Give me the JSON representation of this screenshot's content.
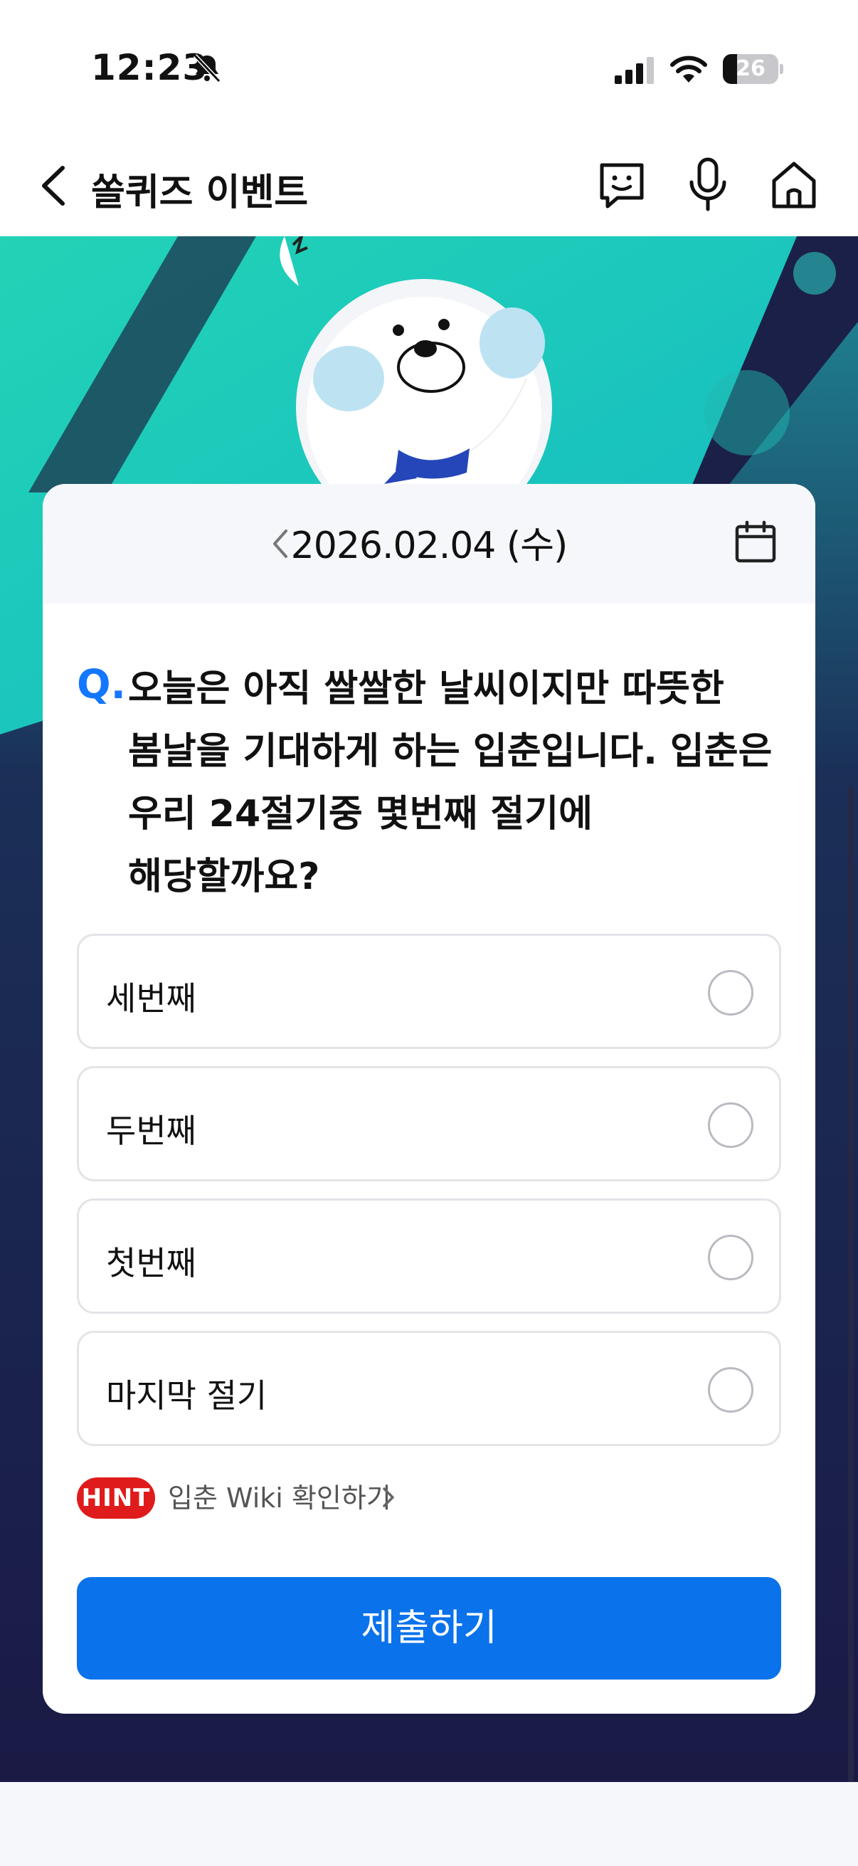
{
  "status_bar": {
    "time": "12:23",
    "battery_level": "26",
    "battery_fraction": 0.26
  },
  "nav": {
    "title": "쏠퀴즈 이벤트",
    "icons": [
      "back-icon",
      "chat-icon",
      "mic-icon",
      "home-icon"
    ]
  },
  "quiz": {
    "date": "2026.02.04 (수)",
    "question_prefix": "Q.",
    "question": "오늘은 아직 쌀쌀한 날씨이지만 따뜻한 봄날을 기대하게 하는 입춘입니다. 입춘은 우리 24절기중 몇번째 절기에 해당할까요?",
    "options": [
      {
        "label": "세번째",
        "selected": false
      },
      {
        "label": "두번째",
        "selected": false
      },
      {
        "label": "첫번째",
        "selected": false
      },
      {
        "label": "마지막 절기",
        "selected": false
      }
    ],
    "hint_badge": "HINT",
    "hint_link": "입춘 Wiki 확인하기",
    "submit_label": "제출하기"
  },
  "colors": {
    "accent": "#0a72ea",
    "question_mark": "#1477ff",
    "hint_badge": "#e01b1b",
    "banner_teal": "#19c3b4",
    "banner_navy": "#1d1e4a"
  }
}
